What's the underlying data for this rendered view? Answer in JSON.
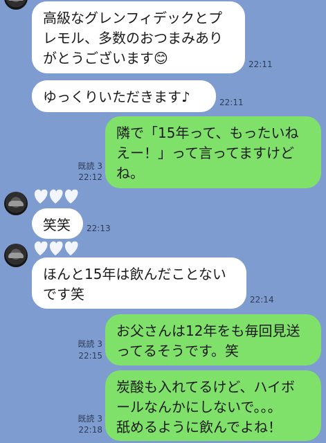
{
  "chat": {
    "messages": [
      {
        "id": "m1",
        "side": "in",
        "text_lines": [
          "高級なグレンフィデックとプ",
          "レモル、多数のおつまみあり",
          "がとうございます😊"
        ],
        "time": "22:11"
      },
      {
        "id": "m2",
        "side": "in",
        "text_lines": [
          "ゆっくりいただきます♪"
        ],
        "time": "22:11"
      },
      {
        "id": "m3",
        "side": "out",
        "text_lines": [
          "隣で「15年って、もったいね",
          "えー！」って言ってますけど",
          "ね。"
        ],
        "read": "既読 3",
        "time": "22:12"
      },
      {
        "id": "m4",
        "side": "in",
        "text_lines": [
          "笑笑"
        ],
        "time": "22:13"
      },
      {
        "id": "m5",
        "side": "in",
        "text_lines": [
          "ほんと15年は飲んだことない",
          "です笑"
        ],
        "time": "22:14"
      },
      {
        "id": "m6",
        "side": "out",
        "text_lines": [
          "お父さんは12年をも毎回見送",
          "ってるそうです。笑"
        ],
        "read": "既読 3",
        "time": "22:15"
      },
      {
        "id": "m7",
        "side": "out",
        "text_lines": [
          "炭酸も入れてるけど、ハイボ",
          "ールなんかにしないで。。。",
          "舐めるように飲んでよね！"
        ],
        "read": "既読 3",
        "time": "22:18"
      }
    ]
  },
  "colors": {
    "background": "#7e9ccf",
    "incoming": "#ffffff",
    "outgoing": "#7fe169"
  },
  "icons": {
    "avatar": "sender-avatar",
    "name_placeholder": "hearts-name-sticker"
  }
}
